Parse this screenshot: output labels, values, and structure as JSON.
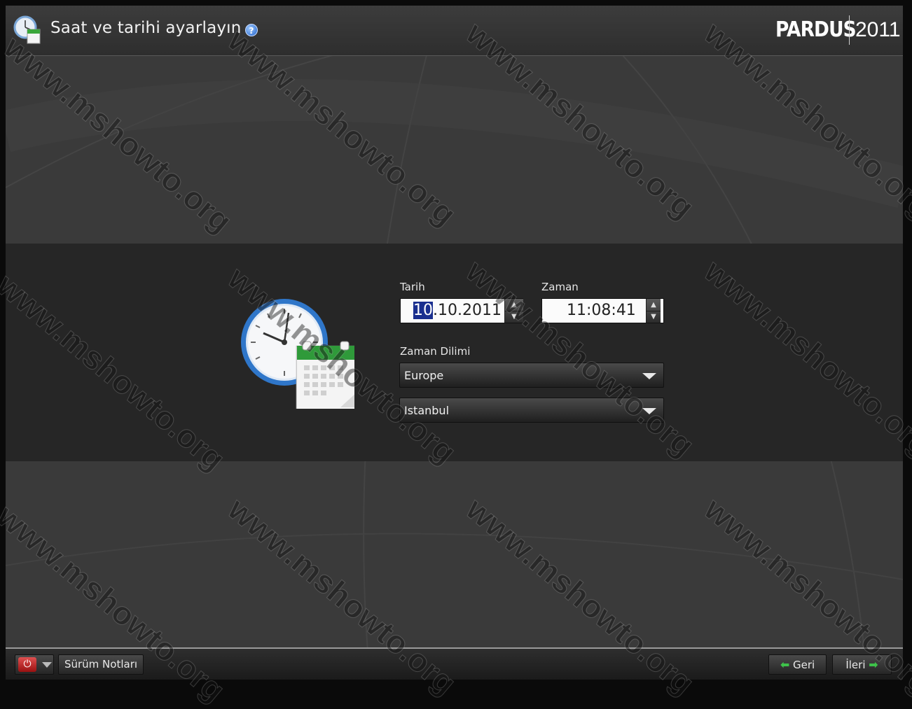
{
  "header": {
    "title": "Saat ve tarihi ayarlayın",
    "help_label": "?",
    "brand_logo": "PARDUS",
    "brand_year": "2011"
  },
  "form": {
    "date_label": "Tarih",
    "date_selected": "10",
    "date_rest": ".10.2011",
    "time_label": "Zaman",
    "time_value": "11:08:41",
    "timezone_label": "Zaman Dilimi",
    "region_value": "Europe",
    "city_value": "Istanbul"
  },
  "footer": {
    "release_notes": "Sürüm Notları",
    "back": "Geri",
    "next": "İleri"
  },
  "watermark": "www.mshowto.org",
  "colors": {
    "background": "#3a3a3a",
    "band": "#262626",
    "selection": "#1a2f8f",
    "accent_green": "#3ec24a",
    "power_red": "#c82020"
  }
}
